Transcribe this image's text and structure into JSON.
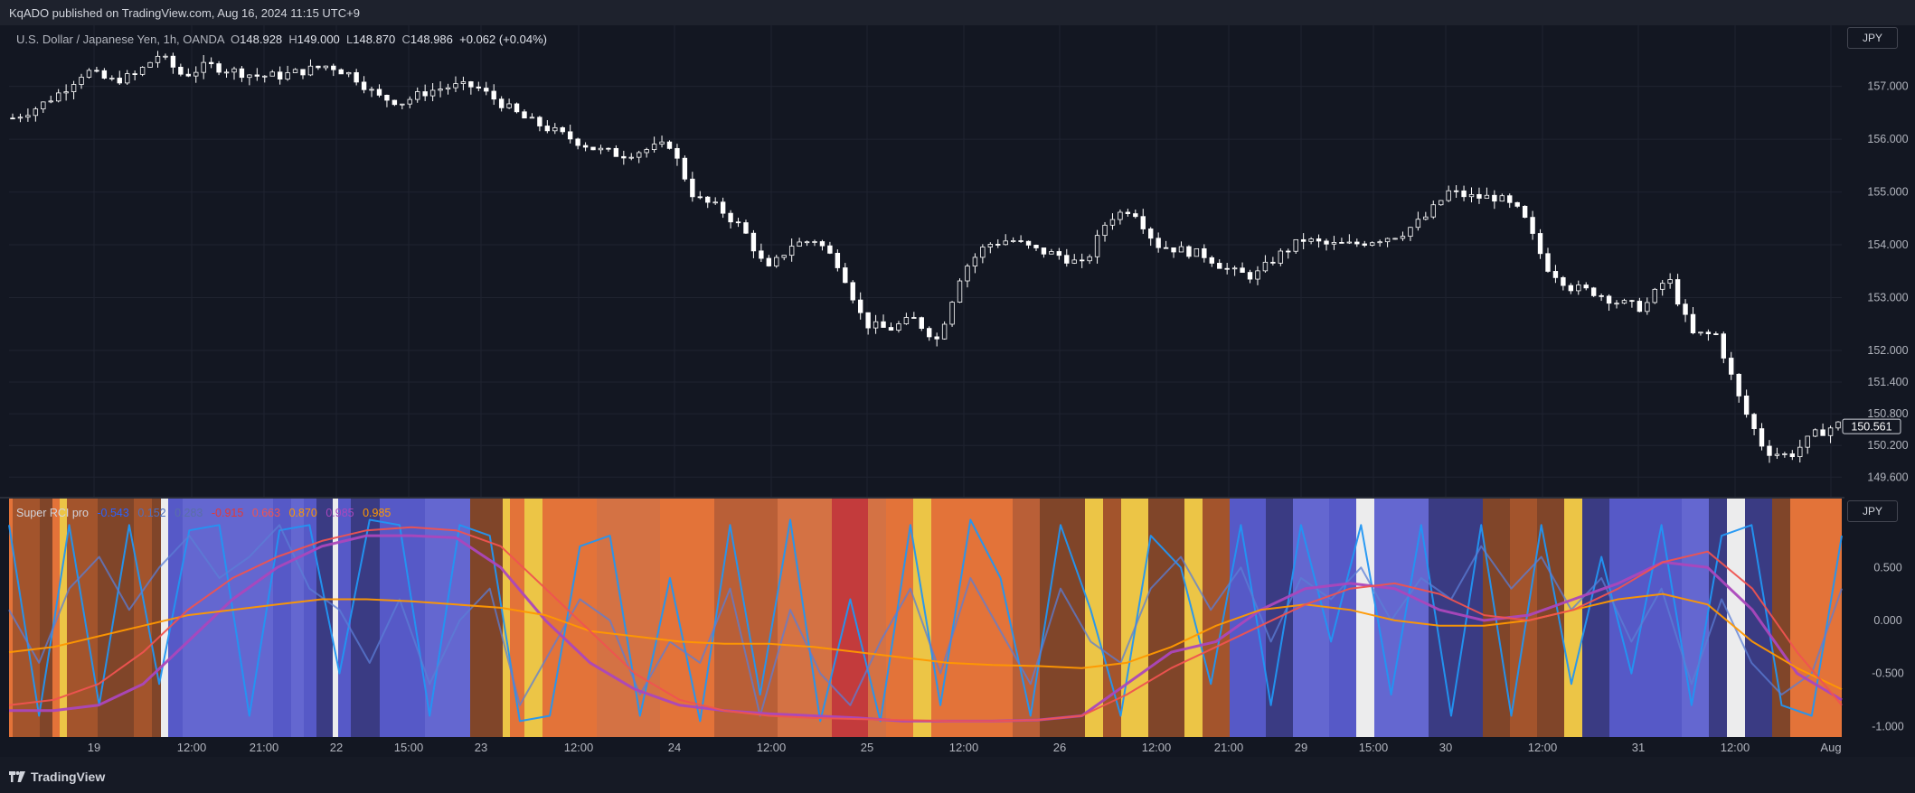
{
  "header": {
    "publish_text": "KqADO published on TradingView.com, Aug 16, 2024 11:15 UTC+9"
  },
  "footer": {
    "brand": "TradingView"
  },
  "symbol": {
    "name": "U.S. Dollar / Japanese Yen, 1h, OANDA",
    "open_label": "O",
    "open": "148.928",
    "high_label": "H",
    "high": "149.000",
    "low_label": "L",
    "low": "148.870",
    "close_label": "C",
    "close": "148.986",
    "change": "+0.062 (+0.04%)"
  },
  "currency_badge": "JPY",
  "indicator": {
    "name": "Super RCI pro",
    "values": [
      "-0.543",
      "0.152",
      "0.283",
      "-0.915",
      "0.663",
      "0.870",
      "0.985",
      "0.985"
    ],
    "value_colors": [
      "#2962ff",
      "#4e6fbf",
      "#5a6fa8",
      "#e53935",
      "#ef5350",
      "#ff9800",
      "#ab47bc",
      "#ff9800"
    ]
  },
  "colors": {
    "background": "#131722",
    "grid": "#1f2330",
    "candle_body": "#ffffff",
    "price_label_bg": "#131722",
    "orange_band": "#f57c3c",
    "blue_band": "#5c5fd6",
    "yellow_band": "#ffd54a",
    "red_band": "#d33f3f"
  },
  "chart_data": [
    {
      "type": "candlestick",
      "title": "U.S. Dollar / Japanese Yen, 1h, OANDA",
      "y_axis_ticks": [
        "157.000",
        "156.000",
        "155.000",
        "154.000",
        "153.000",
        "152.000",
        "151.400",
        "150.800",
        "150.200",
        "149.600"
      ],
      "ylim": [
        149.4,
        157.9
      ],
      "last_price": "150.561",
      "x_axis_ticks": [
        "19",
        "12:00",
        "21:00",
        "22",
        "15:00",
        "23",
        "12:00",
        "24",
        "12:00",
        "25",
        "12:00",
        "26",
        "12:00",
        "21:00",
        "29",
        "15:00",
        "30",
        "12:00",
        "31",
        "12:00",
        "Aug"
      ],
      "close_path": [
        156.4,
        156.6,
        156.9,
        157.3,
        157.1,
        157.2,
        157.6,
        157.2,
        157.4,
        157.3,
        157.2,
        157.2,
        157.3,
        157.4,
        157.2,
        156.8,
        156.7,
        156.9,
        157.0,
        157.0,
        156.7,
        156.4,
        156.2,
        156.0,
        155.8,
        155.7,
        155.8,
        155.9,
        154.9,
        154.7,
        154.3,
        153.5,
        154.0,
        154.1,
        153.6,
        152.5,
        152.4,
        152.6,
        152.2,
        153.5,
        154.0,
        154.1,
        153.9,
        153.8,
        153.6,
        154.5,
        154.7,
        154.0,
        153.9,
        153.8,
        153.5,
        153.4,
        153.8,
        154.1,
        154.0,
        154.0,
        154.1,
        154.2,
        154.5,
        155.0,
        154.9,
        154.9,
        154.6,
        153.6,
        153.2,
        153.1,
        152.9,
        152.8,
        153.4,
        152.3,
        152.3,
        151.0,
        150.1,
        150.0,
        150.4,
        150.6
      ]
    },
    {
      "type": "line",
      "title": "Super RCI pro",
      "y_axis_ticks": [
        "0.500",
        "0.000",
        "-0.500",
        "-1.000"
      ],
      "ylim": [
        -1.1,
        1.15
      ],
      "series": [
        {
          "color": "#2196f3",
          "values": [
            0.9,
            -0.9,
            0.9,
            -0.8,
            0.9,
            -0.6,
            0.85,
            0.9,
            -0.9,
            0.85,
            0.9,
            -0.5,
            0.95,
            0.9,
            -0.9,
            0.9,
            0.8,
            -0.95,
            -0.9,
            0.7,
            0.8,
            -0.9,
            0.4,
            -0.95,
            0.9,
            -0.7,
            0.95,
            -0.95,
            0.2,
            -0.95,
            0.9,
            -0.8,
            0.95,
            0.4,
            -0.9,
            0.9,
            0.1,
            -0.9,
            0.8,
            0.5,
            -0.6,
            0.9,
            -0.8,
            0.9,
            -0.2,
            0.9,
            -0.7,
            0.9,
            -0.9,
            0.9,
            -0.9,
            0.9,
            -0.6,
            0.6,
            -0.5,
            0.9,
            -0.8,
            0.8,
            0.9,
            -0.8,
            -0.9,
            0.8
          ]
        },
        {
          "color": "#5b7dd6",
          "values": [
            0.1,
            -0.4,
            0.3,
            0.6,
            0.1,
            0.5,
            0.8,
            0.4,
            0.6,
            0.9,
            0.3,
            0.1,
            -0.4,
            0.2,
            -0.6,
            0.0,
            0.3,
            -0.8,
            -0.3,
            0.2,
            0.0,
            -0.7,
            -0.2,
            -0.4,
            0.3,
            -0.9,
            0.1,
            -0.5,
            -0.8,
            -0.2,
            0.3,
            -0.5,
            0.4,
            -0.1,
            -0.6,
            0.3,
            -0.2,
            -0.4,
            0.3,
            0.6,
            0.1,
            0.5,
            -0.2,
            0.4,
            0.2,
            0.5,
            0.0,
            0.4,
            0.2,
            0.7,
            0.3,
            0.6,
            0.1,
            0.4,
            -0.2,
            0.3,
            -0.6,
            0.2,
            -0.4,
            -0.7,
            -0.5,
            0.3
          ]
        },
        {
          "color": "#ab47bc",
          "values": [
            -0.85,
            -0.85,
            -0.8,
            -0.6,
            -0.2,
            0.2,
            0.5,
            0.7,
            0.8,
            0.8,
            0.78,
            0.5,
            0.0,
            -0.4,
            -0.65,
            -0.8,
            -0.85,
            -0.88,
            -0.9,
            -0.92,
            -0.95,
            -0.95,
            -0.95,
            -0.94,
            -0.9,
            -0.6,
            -0.3,
            -0.2,
            0.1,
            0.3,
            0.35,
            0.3,
            0.1,
            0.0,
            0.05,
            0.2,
            0.35,
            0.55,
            0.5,
            0.1,
            -0.5,
            -0.75
          ]
        },
        {
          "color": "#ff9800",
          "values": [
            -0.3,
            -0.25,
            -0.15,
            -0.05,
            0.05,
            0.1,
            0.15,
            0.2,
            0.2,
            0.18,
            0.15,
            0.12,
            0.05,
            -0.1,
            -0.15,
            -0.2,
            -0.22,
            -0.22,
            -0.25,
            -0.3,
            -0.35,
            -0.4,
            -0.42,
            -0.43,
            -0.45,
            -0.4,
            -0.25,
            -0.05,
            0.1,
            0.15,
            0.1,
            0.0,
            -0.05,
            -0.05,
            0.0,
            0.1,
            0.2,
            0.25,
            0.15,
            -0.2,
            -0.45,
            -0.65
          ]
        },
        {
          "color": "#ef5350",
          "values": [
            -0.8,
            -0.75,
            -0.6,
            -0.3,
            0.1,
            0.4,
            0.6,
            0.75,
            0.85,
            0.88,
            0.85,
            0.7,
            0.3,
            -0.1,
            -0.5,
            -0.75,
            -0.85,
            -0.9,
            -0.92,
            -0.93,
            -0.94,
            -0.95,
            -0.95,
            -0.94,
            -0.9,
            -0.7,
            -0.45,
            -0.25,
            -0.05,
            0.15,
            0.3,
            0.35,
            0.25,
            0.05,
            0.0,
            0.1,
            0.3,
            0.55,
            0.65,
            0.3,
            -0.3,
            -0.8
          ]
        }
      ]
    }
  ]
}
